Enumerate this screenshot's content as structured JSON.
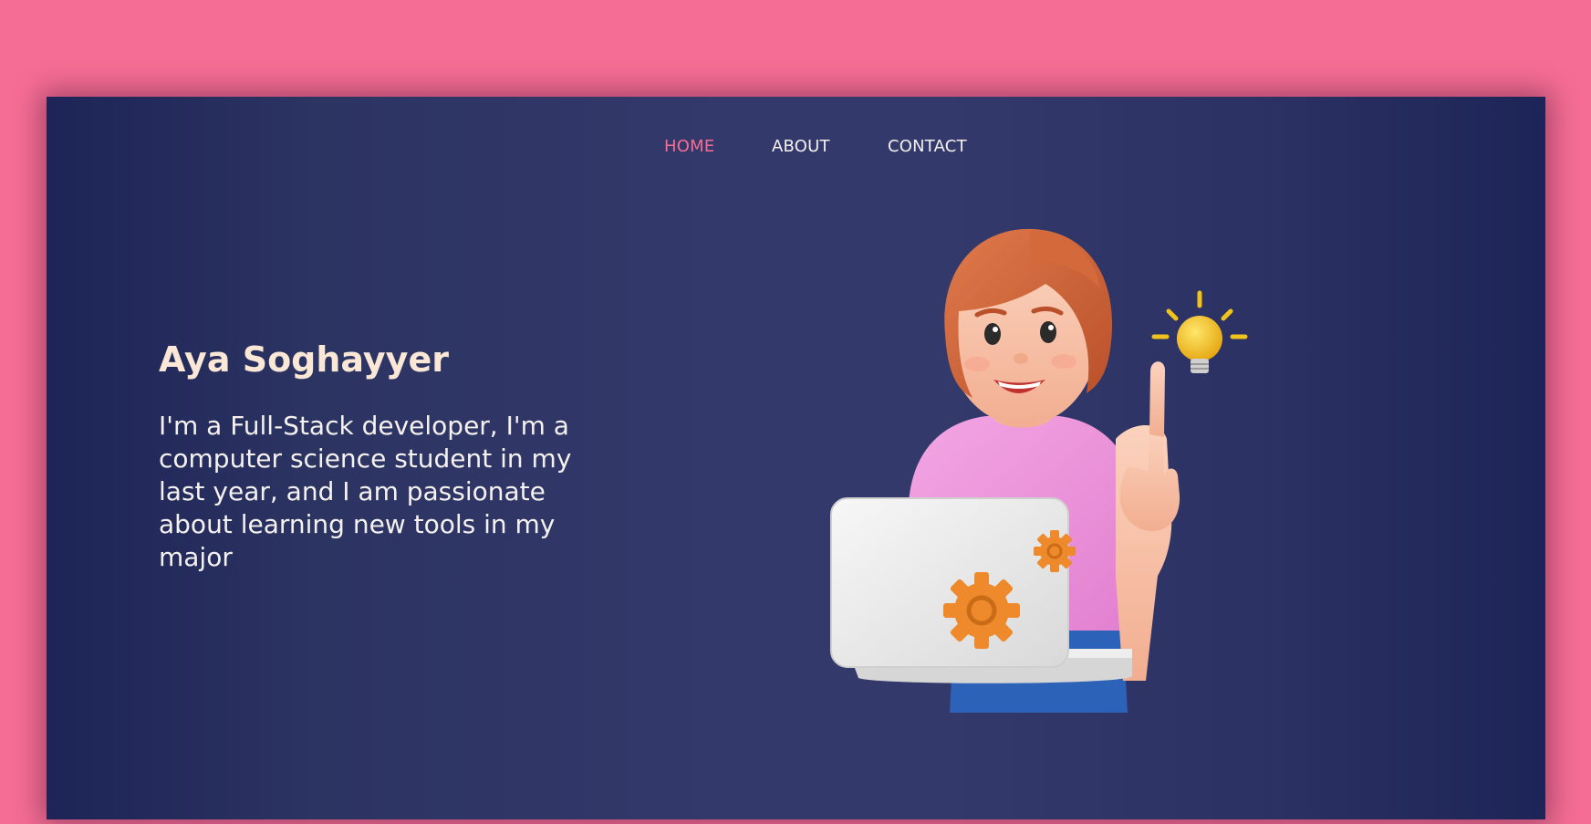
{
  "nav": {
    "items": [
      {
        "label": "HOME",
        "active": true
      },
      {
        "label": "ABOUT",
        "active": false
      },
      {
        "label": "CONTACT",
        "active": false
      }
    ]
  },
  "hero": {
    "name": "Aya Soghayyer",
    "bio": "I'm a Full-Stack developer, I'm a computer science student in my last year, and I am passionate about learning new tools in my major"
  },
  "colors": {
    "page_background": "#f56d94",
    "card_background": "#33396b",
    "accent": "#f56d94",
    "heading": "#fbe7d5",
    "text": "#f5f1ef"
  },
  "icons": [
    "girl-with-laptop-illustration",
    "lightbulb-icon",
    "gear-icon"
  ]
}
